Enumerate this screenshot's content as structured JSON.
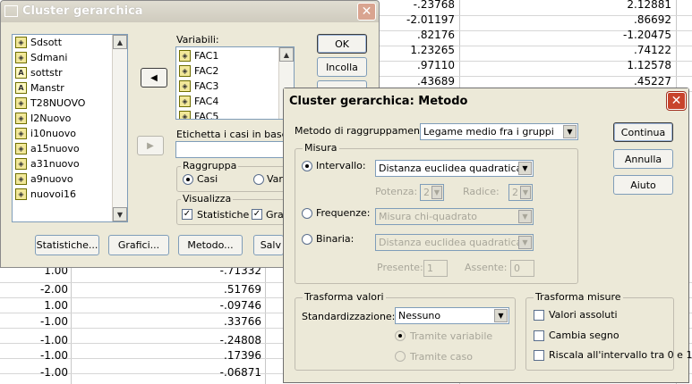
{
  "spreadsheet": {
    "top_values": [
      {
        "a": "-.23768",
        "b": "2.12881"
      },
      {
        "a": "-2.01197",
        "b": ".86692"
      },
      {
        "a": ".82176",
        "b": "-1.20475"
      },
      {
        "a": "1.23265",
        "b": ".74122"
      },
      {
        "a": ".97110",
        "b": "1.12578"
      },
      {
        "a": ".43689",
        "b": ".45227"
      }
    ],
    "bottom_rows": [
      {
        "col1": "1.00",
        "col2": "-.71332"
      },
      {
        "col1": "-2.00",
        "col2": ".51769"
      },
      {
        "col1": "1.00",
        "col2": "-.09746"
      },
      {
        "col1": "-1.00",
        "col2": ".33766"
      },
      {
        "col1": "-1.00",
        "col2": "-.24808"
      },
      {
        "col1": "-1.00",
        "col2": ".17396"
      },
      {
        "col1": "-1.00",
        "col2": "-.06871"
      }
    ]
  },
  "main_dialog": {
    "title": "Cluster gerarchica",
    "source_list": [
      {
        "label": "Sdsott",
        "icon": "ruler-icon"
      },
      {
        "label": "Sdmani",
        "icon": "ruler-icon"
      },
      {
        "label": "sottstr",
        "icon": "string-icon"
      },
      {
        "label": "Manstr",
        "icon": "string-icon"
      },
      {
        "label": "T28NUOVO",
        "icon": "ruler-icon"
      },
      {
        "label": "I2Nuovo",
        "icon": "ruler-icon"
      },
      {
        "label": "i10nuovo",
        "icon": "ruler-icon"
      },
      {
        "label": "a15nuovo",
        "icon": "ruler-icon"
      },
      {
        "label": "a31nuovo",
        "icon": "ruler-icon"
      },
      {
        "label": "a9nuovo",
        "icon": "ruler-icon"
      },
      {
        "label": "nuovoi16",
        "icon": "ruler-icon"
      }
    ],
    "variables_label": "Variabili:",
    "variables": [
      "FAC1",
      "FAC2",
      "FAC3",
      "FAC4",
      "FAC5"
    ],
    "label_cases_label": "Etichetta i casi in base a:",
    "group_raggruppa": "Raggruppa",
    "radio_casi": "Casi",
    "radio_variabili": "Vari",
    "group_visualizza": "Visualizza",
    "chk_statistiche": "Statistiche",
    "chk_grafici": "Graf",
    "btn_ok": "OK",
    "btn_incolla": "Incolla",
    "btn_statistiche": "Statistiche...",
    "btn_grafici": "Grafici...",
    "btn_metodo": "Metodo...",
    "btn_salva": "Salv"
  },
  "method_dialog": {
    "title": "Cluster gerarchica: Metodo",
    "method_label": "Metodo di raggruppamento:",
    "method_value": "Legame medio fra i gruppi",
    "group_misura": "Misura",
    "radio_intervallo": "Intervallo:",
    "intervallo_value": "Distanza euclidea quadratica",
    "potenza_label": "Potenza:",
    "potenza_value": "2",
    "radice_label": "Radice:",
    "radice_value": "2",
    "radio_frequenze": "Frequenze:",
    "frequenze_value": "Misura chi-quadrato",
    "radio_binaria": "Binaria:",
    "binaria_value": "Distanza euclidea quadratica",
    "presente_label": "Presente:",
    "presente_value": "1",
    "assente_label": "Assente:",
    "assente_value": "0",
    "group_trasforma_valori": "Trasforma valori",
    "standardizzazione_label": "Standardizzazione:",
    "standardizzazione_value": "Nessuno",
    "radio_tramite_variabile": "Tramite variabile",
    "radio_tramite_caso": "Tramite caso",
    "group_trasforma_misure": "Trasforma misure",
    "chk_valori_assoluti": "Valori assoluti",
    "chk_cambia_segno": "Cambia segno",
    "chk_riscala": "Riscala all'intervallo tra 0 e 1",
    "btn_continua": "Continua",
    "btn_annulla": "Annulla",
    "btn_aiuto": "Aiuto"
  },
  "colors": {
    "titlebar_active": "#0a246a",
    "titlebar_inactive": "#d4d0c8",
    "dialog_bg": "#ece9d8",
    "close_red": "#c8442c"
  }
}
